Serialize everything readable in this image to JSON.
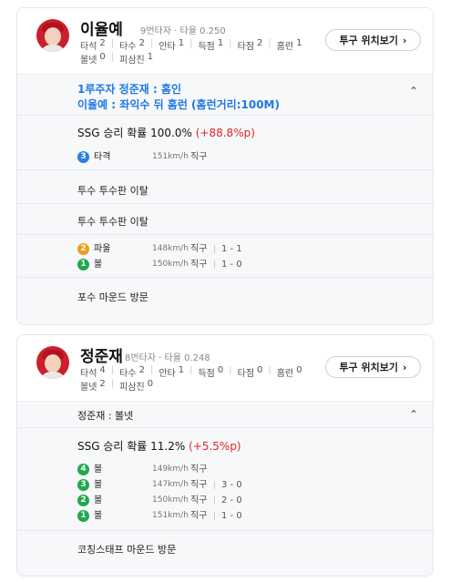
{
  "card1": {
    "name": "이율예",
    "batting_order": "9번타자",
    "avg_label": "타율",
    "avg": "0.250",
    "stats_row1": [
      {
        "label": "타석",
        "value": "2"
      },
      {
        "label": "타수",
        "value": "2"
      },
      {
        "label": "안타",
        "value": "1"
      },
      {
        "label": "득점",
        "value": "1"
      },
      {
        "label": "타점",
        "value": "2"
      },
      {
        "label": "홈런",
        "value": "1"
      }
    ],
    "stats_row2": [
      {
        "label": "볼넷",
        "value": "0"
      },
      {
        "label": "피삼진",
        "value": "1"
      }
    ],
    "pitch_button": "투구 위치보기",
    "highlight_lines": [
      "1루주자 정준재 : 홈인",
      "이율예 : 좌익수 뒤 홈런 (홈런거리:100M)"
    ],
    "win_prob": "SSG 승리 확률 100.0%",
    "win_delta": "(+88.8%p)",
    "pitch_top": {
      "num": "3",
      "result": "타격",
      "speed": "151km/h",
      "type": "직구",
      "count": ""
    },
    "event1": "투수 투수판 이탈",
    "event2": "투수 투수판 이탈",
    "pitches": [
      {
        "num": "2",
        "result": "파울",
        "speed": "148km/h",
        "type": "직구",
        "count": "1 - 1"
      },
      {
        "num": "1",
        "result": "볼",
        "speed": "150km/h",
        "type": "직구",
        "count": "1 - 0"
      }
    ],
    "event3": "포수 마운드 방문"
  },
  "card2": {
    "name": "정준재",
    "batting_order": "8번타자",
    "avg_label": "타율",
    "avg": "0.248",
    "stats_row1": [
      {
        "label": "타석",
        "value": "4"
      },
      {
        "label": "타수",
        "value": "2"
      },
      {
        "label": "안타",
        "value": "1"
      },
      {
        "label": "득점",
        "value": "0"
      },
      {
        "label": "타점",
        "value": "0"
      },
      {
        "label": "홈런",
        "value": "0"
      }
    ],
    "stats_row2": [
      {
        "label": "볼넷",
        "value": "2"
      },
      {
        "label": "피삼진",
        "value": "0"
      }
    ],
    "pitch_button": "투구 위치보기",
    "result_line": "정준재 : 볼넷",
    "win_prob": "SSG 승리 확률 11.2%",
    "win_delta": "(+5.5%p)",
    "pitches": [
      {
        "num": "4",
        "result": "볼",
        "speed": "149km/h",
        "type": "직구",
        "count": ""
      },
      {
        "num": "3",
        "result": "볼",
        "speed": "147km/h",
        "type": "직구",
        "count": "3 - 0"
      },
      {
        "num": "2",
        "result": "볼",
        "speed": "150km/h",
        "type": "직구",
        "count": "2 - 0"
      },
      {
        "num": "1",
        "result": "볼",
        "speed": "151km/h",
        "type": "직구",
        "count": "1 - 0"
      }
    ],
    "event1": "코칭스태프 마운드 방문"
  },
  "icons": {
    "chevron_right": "›",
    "chevron_up": "⌃"
  },
  "colors": {
    "highlight": "#1e78e6",
    "delta_red": "#e0242b",
    "hit_blue": "#2b7de9",
    "foul_orange": "#f39a1c",
    "ball_green": "#1fa84f"
  }
}
